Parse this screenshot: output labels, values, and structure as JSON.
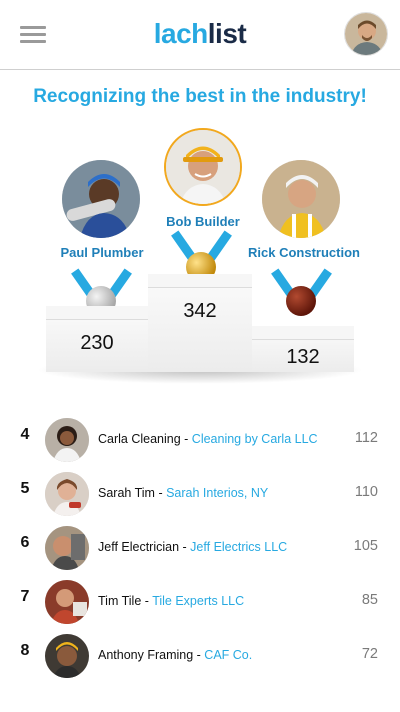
{
  "header": {
    "logo_part1": "lach",
    "logo_part2": "list"
  },
  "title": "Recognizing the best in the industry!",
  "podium": {
    "first": {
      "name": "Bob Builder",
      "score": "342",
      "medal": "gold",
      "color": "#d9a21b"
    },
    "second": {
      "name": "Paul Plumber",
      "score": "230",
      "medal": "silver",
      "color": "#bfbfbf"
    },
    "third": {
      "name": "Rick Construction",
      "score": "132",
      "medal": "bronze",
      "color": "#8a2a18"
    }
  },
  "list": [
    {
      "rank": "4",
      "name": "Carla Cleaning",
      "sep": " - ",
      "company": "Cleaning by Carla LLC",
      "score": "112"
    },
    {
      "rank": "5",
      "name": "Sarah Tim",
      "sep": " - ",
      "company": "Sarah Interios, NY",
      "score": "110"
    },
    {
      "rank": "6",
      "name": "Jeff Electrician",
      "sep": " - ",
      "company": "Jeff Electrics LLC",
      "score": "105"
    },
    {
      "rank": "7",
      "name": "Tim Tile",
      "sep": " - ",
      "company": "Tile Experts LLC",
      "score": "85"
    },
    {
      "rank": "8",
      "name": "Anthony Framing",
      "sep": " - ",
      "company": "CAF Co.",
      "score": "72"
    }
  ],
  "colors": {
    "accent": "#27a9e1",
    "logo_dark": "#1a2b47",
    "gold": "#d9a21b",
    "silver": "#bfbfbf",
    "bronze": "#8a2a18"
  }
}
